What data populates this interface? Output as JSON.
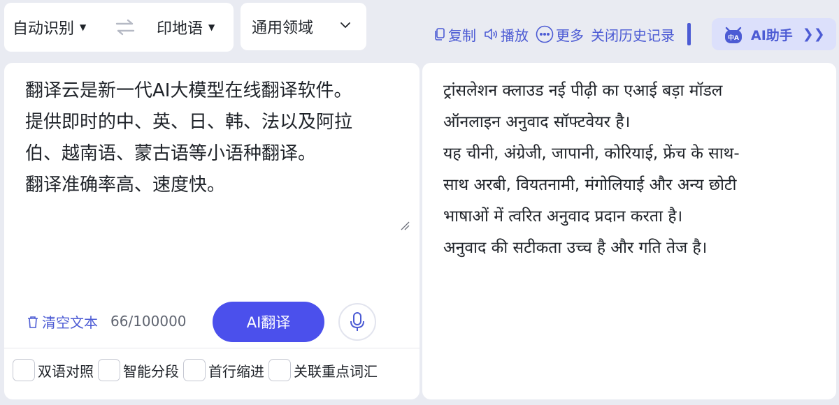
{
  "language_bar": {
    "source_language": "自动识别",
    "target_language": "印地语",
    "domain": "通用领域"
  },
  "toolbar": {
    "copy_label": "复制",
    "play_label": "播放",
    "more_label": "更多",
    "history_label": "关闭历史记录",
    "ai_helper_label": "AI助手",
    "ai_helper_badge": "中A"
  },
  "source": {
    "lines": [
      "翻译云是新一代AI大模型在线翻译软件。",
      "提供即时的中、英、日、韩、法以及阿拉",
      "伯、越南语、蒙古语等小语种翻译。",
      "翻译准确率高、速度快。"
    ],
    "clear_label": "清空文本",
    "char_count": "66/100000",
    "translate_label": "AI翻译"
  },
  "options": [
    {
      "label": "双语对照"
    },
    {
      "label": "智能分段"
    },
    {
      "label": "首行缩进"
    },
    {
      "label": "关联重点词汇"
    }
  ],
  "target": {
    "lines": [
      "ट्रांसलेशन क्लाउड नई पीढ़ी का एआई बड़ा मॉडल",
      "ऑनलाइन अनुवाद सॉफ्टवेयर है।",
      "यह चीनी, अंग्रेजी, जापानी, कोरियाई, फ्रेंच के साथ-",
      "साथ अरबी, वियतनामी, मंगोलियाई और अन्य छोटी",
      "भाषाओं में त्वरित अनुवाद प्रदान करता है।",
      "अनुवाद की सटीकता उच्च है और गति तेज है।"
    ]
  },
  "colors": {
    "accent": "#4b50ec",
    "link": "#4c5bd4",
    "background": "#e9ebf2"
  }
}
